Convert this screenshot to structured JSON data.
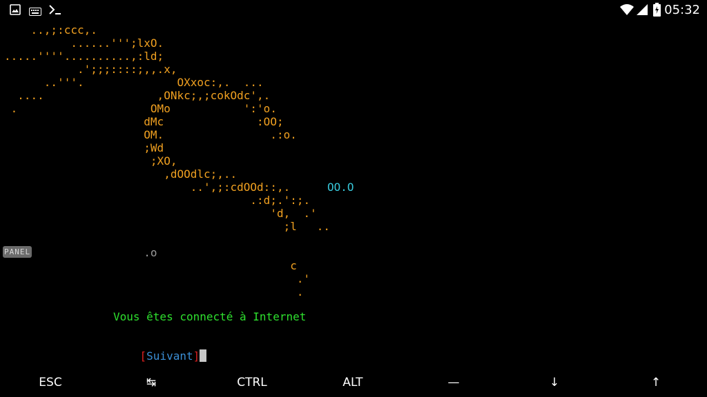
{
  "statusbar": {
    "icons_left": [
      "image-icon",
      "keyboard-icon",
      "terminal-icon"
    ],
    "icons_right": [
      "wifi-icon",
      "signal-icon",
      "battery-icon"
    ],
    "time": "05:32"
  },
  "terminal": {
    "ascii_lines": [
      "    ..,;:ccc,.",
      "          ......''';lxO.",
      ".....''''..........,:ld;",
      "           .';;;::::;,,.x,",
      "      ..'''.              OXxoc:,.  ...",
      "  ....                 ,ONkc;,;cokOdc',.",
      " .                    OMo           ':'o.",
      "                     dMc              :OO;",
      "                     OM.                .:o.",
      "                     ;Wd",
      "                      ;XO,",
      "                        ,dOOdlc;,..",
      "                            ..',;:cdOOd::,.",
      "                                     .:d;.':;.",
      "                                        'd,  .'",
      "                                          ;l   ..",
      "",
      "                     .o",
      "                                           c",
      "                                            .'",
      "                                            ."
    ],
    "cyan_text": "OO.O",
    "panel_badge": "PANEL",
    "message": "Vous êtes connecté à Internet",
    "bracket_open": "[",
    "next_label": "Suivant",
    "bracket_close": "]"
  },
  "extra_keys": {
    "esc": "ESC",
    "tab": "↹",
    "ctrl": "CTRL",
    "alt": "ALT",
    "dash": "—",
    "down": "↓",
    "up": "↑"
  }
}
